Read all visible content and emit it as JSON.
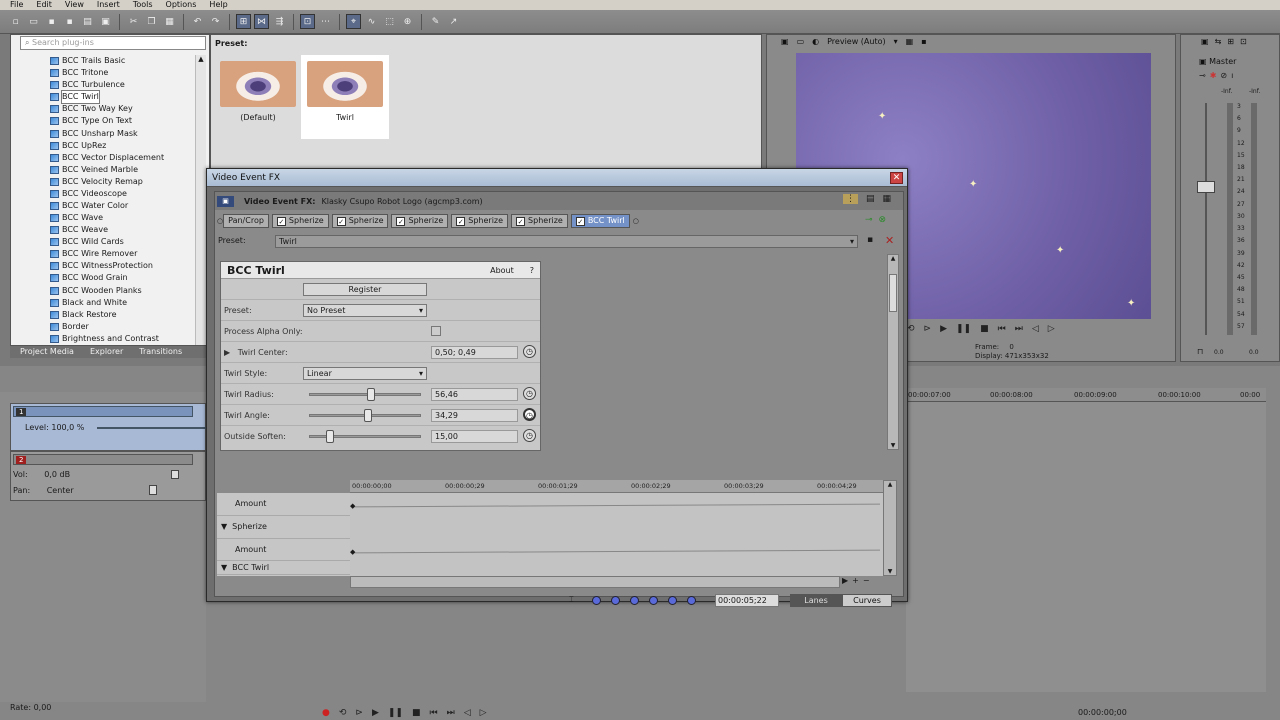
{
  "menu": [
    "File",
    "Edit",
    "View",
    "Insert",
    "Tools",
    "Options",
    "Help"
  ],
  "plugins": {
    "search_placeholder": "Search plug-ins",
    "items": [
      "BCC Trails Basic",
      "BCC Tritone",
      "BCC Turbulence",
      "BCC Twirl",
      "BCC Two Way Key",
      "BCC Type On Text",
      "BCC Unsharp Mask",
      "BCC UpRez",
      "BCC Vector Displacement",
      "BCC Veined Marble",
      "BCC Velocity Remap",
      "BCC Videoscope",
      "BCC Water Color",
      "BCC Wave",
      "BCC Weave",
      "BCC Wild Cards",
      "BCC Wire Remover",
      "BCC WitnessProtection",
      "BCC Wood Grain",
      "BCC Wooden Planks",
      "Black and White",
      "Black Restore",
      "Border",
      "Brightness and Contrast"
    ],
    "selected": "BCC Twirl"
  },
  "panel_tabs": [
    "Project Media",
    "Explorer",
    "Transitions"
  ],
  "preset_panel": {
    "label": "Preset:",
    "thumbs": [
      "(Default)",
      "Twirl"
    ]
  },
  "preview": {
    "mode": "Preview (Auto)",
    "frame_label": "Frame:",
    "frame": "0",
    "display_label": "Display:",
    "display": "471x353x32"
  },
  "mixer": {
    "title": "Master",
    "left_inf": "-Inf.",
    "right_inf": "-Inf.",
    "scale": [
      "3",
      "6",
      "9",
      "12",
      "15",
      "18",
      "21",
      "24",
      "27",
      "30",
      "33",
      "36",
      "39",
      "42",
      "45",
      "48",
      "51",
      "54",
      "57"
    ],
    "left_val": "0.0",
    "right_val": "0.0"
  },
  "timeline": {
    "level": "Level: 100,0 %",
    "vol_label": "Vol:",
    "vol": "0,0 dB",
    "pan_label": "Pan:",
    "pan": "Center",
    "track1_num": "1",
    "track2_num": "2",
    "ruler": [
      "00:00:07:00",
      "00:00:08:00",
      "00:00:09:00",
      "00:00:10:00",
      "00:00"
    ],
    "rate": "Rate: 0,00",
    "time_code": "00:00:00;00"
  },
  "fx": {
    "window_title": "Video Event FX",
    "event_label": "Video Event FX:",
    "event_name": "Klasky Csupo Robot Logo (agcmp3.com)",
    "chain": [
      "Pan/Crop",
      "Spherize",
      "Spherize",
      "Spherize",
      "Spherize",
      "Spherize",
      "BCC Twirl"
    ],
    "preset_label": "Preset:",
    "preset_value": "Twirl",
    "plugin_title": "BCC Twirl",
    "about": "About",
    "help": "?",
    "register": "Register",
    "params": {
      "preset_label": "Preset:",
      "preset_value": "No Preset",
      "alpha_label": "Process Alpha Only:",
      "center_label": "Twirl Center:",
      "center_value": "0,50; 0,49",
      "style_label": "Twirl Style:",
      "style_value": "Linear",
      "radius_label": "Twirl Radius:",
      "radius_value": "56,46",
      "radius_fraction": 0.55,
      "angle_label": "Twirl Angle:",
      "angle_value": "34,29",
      "angle_fraction": 0.52,
      "soften_label": "Outside Soften:",
      "soften_value": "15,00",
      "soften_fraction": 0.15
    },
    "kf_ruler": [
      "00:00:00;00",
      "00:00:00;29",
      "00:00:01;29",
      "00:00:02;29",
      "00:00:03;29",
      "00:00:04;29"
    ],
    "kf_rows": [
      "Amount",
      "Spherize",
      "Amount",
      "BCC Twirl"
    ],
    "kf_time": "00:00:05;22",
    "lanes_btn": "Lanes",
    "curves_btn": "Curves"
  }
}
